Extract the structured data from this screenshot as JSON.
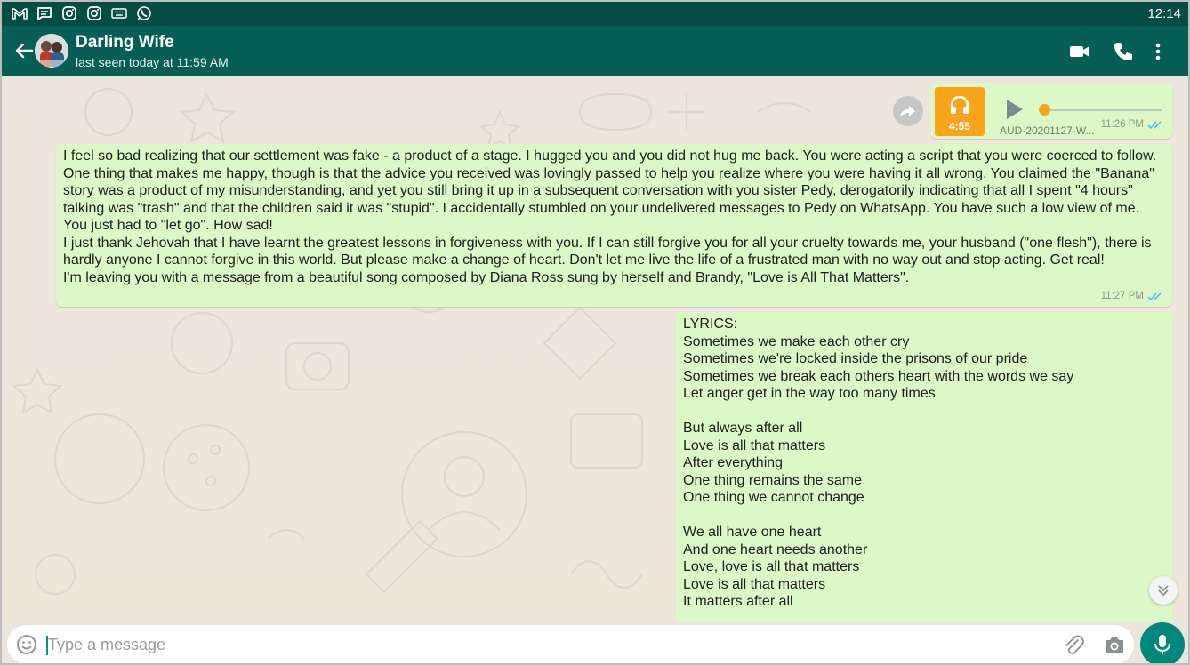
{
  "status_bar": {
    "time": "12:14",
    "notification_icons": [
      "gmail-icon",
      "message-icon",
      "instagram-icon",
      "instagram-icon",
      "keyboard-icon",
      "whatsapp-icon"
    ]
  },
  "header": {
    "contact_name": "Darling Wife",
    "last_seen": "last seen today at 11:59 AM",
    "icons": [
      "back-arrow-icon",
      "video-call-icon",
      "voice-call-icon",
      "more-options-icon"
    ]
  },
  "messages": [
    {
      "type": "audio",
      "duration": "4:55",
      "file_name": "AUD-20201127-W...",
      "time": "11:26 PM",
      "progress": 0,
      "status": "read"
    },
    {
      "type": "text",
      "text": "I feel so bad realizing that our settlement was fake - a product of a stage. I hugged you and you did not hug me back. You were acting a script that you were coerced to follow. One thing that makes me happy, though is that the advice you received was lovingly passed to help you realize where you were having it all wrong. You claimed the \"Banana\" story was a product of my misunderstanding, and yet you still bring it up in a subsequent conversation with you sister Pedy, derogatorily indicating that all I spent \"4 hours\" talking was \"trash\" and that the children said it was \"stupid\". I accidentally stumbled on your undelivered messages to Pedy on WhatsApp. You have such a low view of me. You just had to \"let go\". How sad!\nI just thank Jehovah that I have learnt the greatest lessons in forgiveness with you. If I can still forgive you for all your cruelty towards me, your husband (\"one flesh\"), there is hardly anyone I cannot forgive in this world. But please make a change of heart. Don't let me live the life of a frustrated man with no way out and stop acting. Get real!\nI'm leaving you with a message from a beautiful song composed by Diana Ross sung by herself and Brandy, \"Love is All That Matters\".",
      "time": "11:27 PM",
      "status": "read"
    },
    {
      "type": "text",
      "text": "LYRICS:\nSometimes we make each other cry\nSometimes we're locked inside the prisons of our pride\nSometimes we break each others heart with the words we say\nLet anger get in the way too many times\n\nBut always after all\nLove is all that matters\nAfter everything\nOne thing remains the same\nOne thing we cannot change\n\nWe all have one heart\nAnd one heart needs another\nLove, love is all that matters\nLove is all that matters\nIt matters after all"
    }
  ],
  "input": {
    "placeholder": "Type a message",
    "value": ""
  },
  "colors": {
    "header": "#075e54",
    "status_bar": "#054d44",
    "outgoing_bubble": "#dcf8c6",
    "chat_background": "#ece5dd",
    "audio_accent": "#f8a51c",
    "mic_button": "#00897b",
    "read_ticks": "#4fc3f7"
  }
}
